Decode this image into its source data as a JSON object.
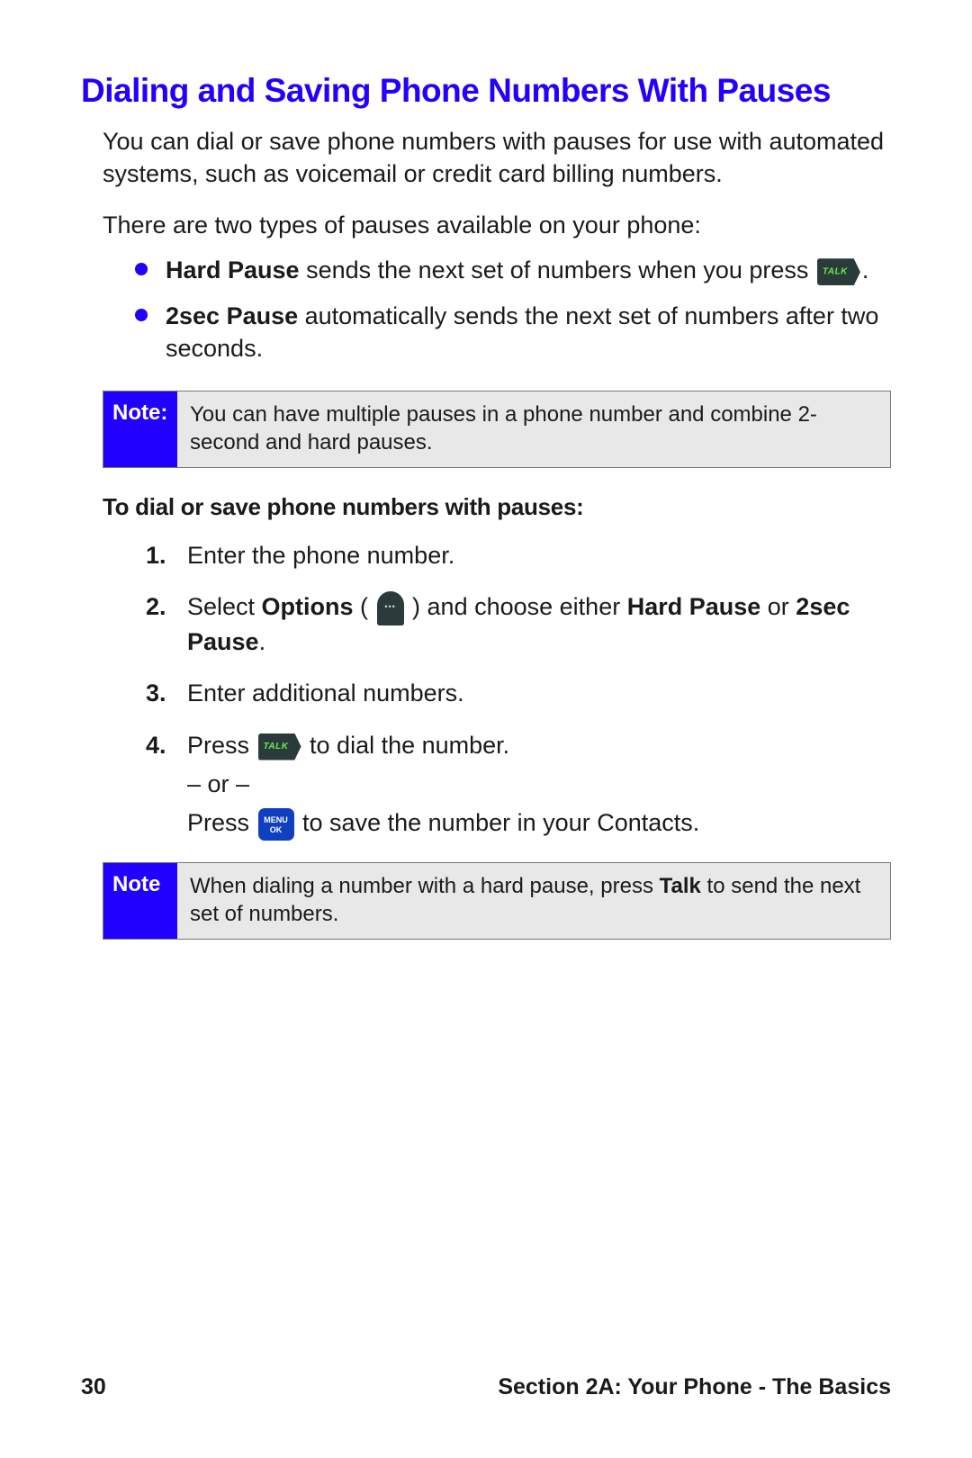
{
  "title": "Dialing and Saving Phone Numbers With Pauses",
  "intro1": "You can dial or save phone numbers with pauses for use with automated systems, such as voicemail or credit card billing numbers.",
  "intro2": "There are two types of pauses available on your phone:",
  "bullets": {
    "hard_b": "Hard Pause",
    "hard_t1": " sends the next set of numbers when you press ",
    "hard_t2": ".",
    "sec_b": "2sec Pause",
    "sec_t": " automatically sends the next set of numbers after two seconds."
  },
  "note1": {
    "label": "Note:",
    "text": "You can have multiple pauses in a phone number and combine 2-second and hard pauses."
  },
  "subhead": "To dial or save phone numbers with pauses:",
  "steps": {
    "s1": "Enter the phone number.",
    "s2_a": "Select ",
    "s2_b1": "Options",
    "s2_c": " ( ",
    "s2_d": " ) and choose either ",
    "s2_b2": "Hard Pause",
    "s2_e": " or ",
    "s2_b3": "2sec Pause",
    "s2_f": ".",
    "s3": "Enter additional numbers.",
    "s4_a": "Press ",
    "s4_b": " to dial the number.",
    "s4_or": "– or –",
    "s4_c": "Press ",
    "s4_d": " to save the number in your Contacts."
  },
  "note2": {
    "label": "Note",
    "t1": "When dialing a number with a hard pause, press ",
    "tb": "Talk",
    "t2": " to send the next set of numbers."
  },
  "footer": {
    "page": "30",
    "section": "Section 2A: Your Phone - The Basics"
  }
}
